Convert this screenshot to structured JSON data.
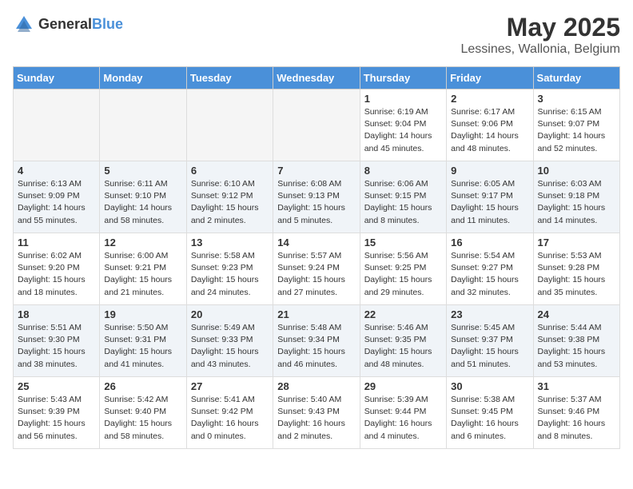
{
  "header": {
    "logo_general": "General",
    "logo_blue": "Blue",
    "title": "May 2025",
    "subtitle": "Lessines, Wallonia, Belgium"
  },
  "weekdays": [
    "Sunday",
    "Monday",
    "Tuesday",
    "Wednesday",
    "Thursday",
    "Friday",
    "Saturday"
  ],
  "weeks": [
    [
      {
        "num": "",
        "info": "",
        "empty": true
      },
      {
        "num": "",
        "info": "",
        "empty": true
      },
      {
        "num": "",
        "info": "",
        "empty": true
      },
      {
        "num": "",
        "info": "",
        "empty": true
      },
      {
        "num": "1",
        "info": "Sunrise: 6:19 AM\nSunset: 9:04 PM\nDaylight: 14 hours\nand 45 minutes."
      },
      {
        "num": "2",
        "info": "Sunrise: 6:17 AM\nSunset: 9:06 PM\nDaylight: 14 hours\nand 48 minutes."
      },
      {
        "num": "3",
        "info": "Sunrise: 6:15 AM\nSunset: 9:07 PM\nDaylight: 14 hours\nand 52 minutes."
      }
    ],
    [
      {
        "num": "4",
        "info": "Sunrise: 6:13 AM\nSunset: 9:09 PM\nDaylight: 14 hours\nand 55 minutes."
      },
      {
        "num": "5",
        "info": "Sunrise: 6:11 AM\nSunset: 9:10 PM\nDaylight: 14 hours\nand 58 minutes."
      },
      {
        "num": "6",
        "info": "Sunrise: 6:10 AM\nSunset: 9:12 PM\nDaylight: 15 hours\nand 2 minutes."
      },
      {
        "num": "7",
        "info": "Sunrise: 6:08 AM\nSunset: 9:13 PM\nDaylight: 15 hours\nand 5 minutes."
      },
      {
        "num": "8",
        "info": "Sunrise: 6:06 AM\nSunset: 9:15 PM\nDaylight: 15 hours\nand 8 minutes."
      },
      {
        "num": "9",
        "info": "Sunrise: 6:05 AM\nSunset: 9:17 PM\nDaylight: 15 hours\nand 11 minutes."
      },
      {
        "num": "10",
        "info": "Sunrise: 6:03 AM\nSunset: 9:18 PM\nDaylight: 15 hours\nand 14 minutes."
      }
    ],
    [
      {
        "num": "11",
        "info": "Sunrise: 6:02 AM\nSunset: 9:20 PM\nDaylight: 15 hours\nand 18 minutes."
      },
      {
        "num": "12",
        "info": "Sunrise: 6:00 AM\nSunset: 9:21 PM\nDaylight: 15 hours\nand 21 minutes."
      },
      {
        "num": "13",
        "info": "Sunrise: 5:58 AM\nSunset: 9:23 PM\nDaylight: 15 hours\nand 24 minutes."
      },
      {
        "num": "14",
        "info": "Sunrise: 5:57 AM\nSunset: 9:24 PM\nDaylight: 15 hours\nand 27 minutes."
      },
      {
        "num": "15",
        "info": "Sunrise: 5:56 AM\nSunset: 9:25 PM\nDaylight: 15 hours\nand 29 minutes."
      },
      {
        "num": "16",
        "info": "Sunrise: 5:54 AM\nSunset: 9:27 PM\nDaylight: 15 hours\nand 32 minutes."
      },
      {
        "num": "17",
        "info": "Sunrise: 5:53 AM\nSunset: 9:28 PM\nDaylight: 15 hours\nand 35 minutes."
      }
    ],
    [
      {
        "num": "18",
        "info": "Sunrise: 5:51 AM\nSunset: 9:30 PM\nDaylight: 15 hours\nand 38 minutes."
      },
      {
        "num": "19",
        "info": "Sunrise: 5:50 AM\nSunset: 9:31 PM\nDaylight: 15 hours\nand 41 minutes."
      },
      {
        "num": "20",
        "info": "Sunrise: 5:49 AM\nSunset: 9:33 PM\nDaylight: 15 hours\nand 43 minutes."
      },
      {
        "num": "21",
        "info": "Sunrise: 5:48 AM\nSunset: 9:34 PM\nDaylight: 15 hours\nand 46 minutes."
      },
      {
        "num": "22",
        "info": "Sunrise: 5:46 AM\nSunset: 9:35 PM\nDaylight: 15 hours\nand 48 minutes."
      },
      {
        "num": "23",
        "info": "Sunrise: 5:45 AM\nSunset: 9:37 PM\nDaylight: 15 hours\nand 51 minutes."
      },
      {
        "num": "24",
        "info": "Sunrise: 5:44 AM\nSunset: 9:38 PM\nDaylight: 15 hours\nand 53 minutes."
      }
    ],
    [
      {
        "num": "25",
        "info": "Sunrise: 5:43 AM\nSunset: 9:39 PM\nDaylight: 15 hours\nand 56 minutes."
      },
      {
        "num": "26",
        "info": "Sunrise: 5:42 AM\nSunset: 9:40 PM\nDaylight: 15 hours\nand 58 minutes."
      },
      {
        "num": "27",
        "info": "Sunrise: 5:41 AM\nSunset: 9:42 PM\nDaylight: 16 hours\nand 0 minutes."
      },
      {
        "num": "28",
        "info": "Sunrise: 5:40 AM\nSunset: 9:43 PM\nDaylight: 16 hours\nand 2 minutes."
      },
      {
        "num": "29",
        "info": "Sunrise: 5:39 AM\nSunset: 9:44 PM\nDaylight: 16 hours\nand 4 minutes."
      },
      {
        "num": "30",
        "info": "Sunrise: 5:38 AM\nSunset: 9:45 PM\nDaylight: 16 hours\nand 6 minutes."
      },
      {
        "num": "31",
        "info": "Sunrise: 5:37 AM\nSunset: 9:46 PM\nDaylight: 16 hours\nand 8 minutes."
      }
    ]
  ]
}
